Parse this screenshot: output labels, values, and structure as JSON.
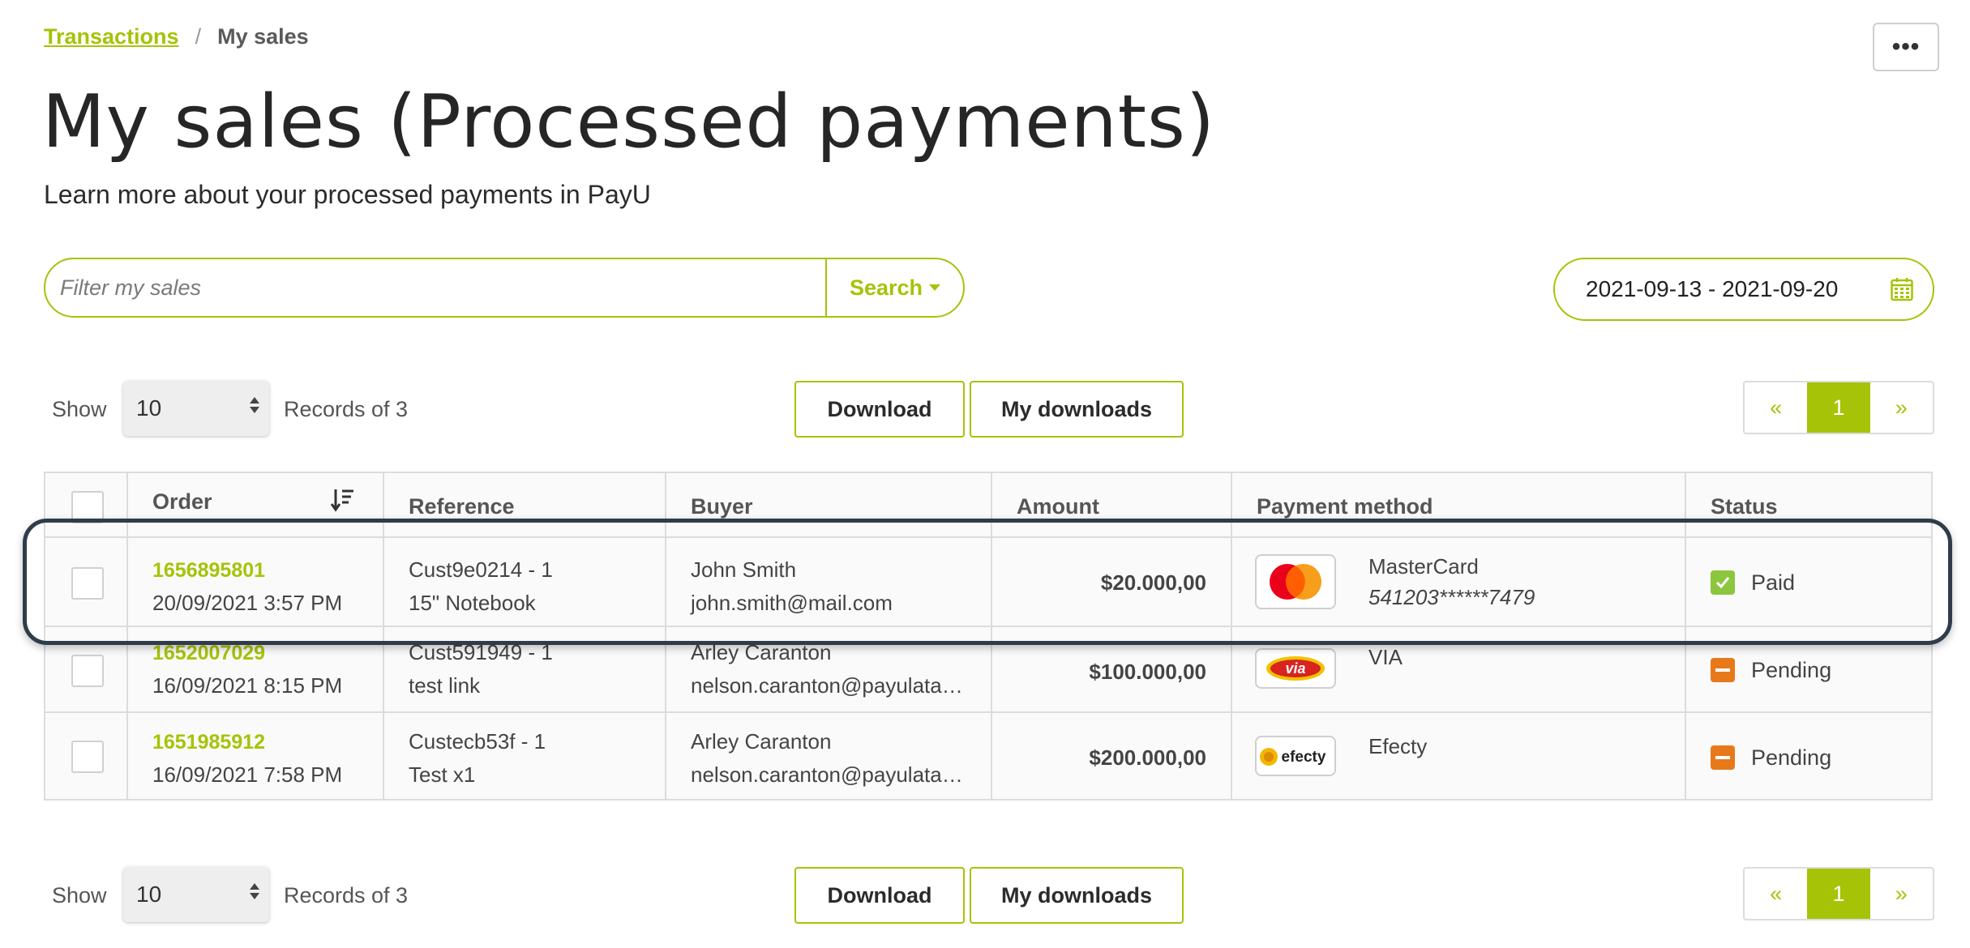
{
  "breadcrumb": {
    "parent": "Transactions",
    "separator": "/",
    "current": "My sales"
  },
  "more_menu": {
    "label": "•••"
  },
  "page": {
    "title": "My sales (Processed payments)",
    "subtitle": "Learn more about your processed payments in PayU"
  },
  "search": {
    "placeholder": "Filter my sales",
    "value": "",
    "button_label": "Search"
  },
  "date_range": {
    "value": "2021-09-13 - 2021-09-20",
    "icon": "calendar-icon"
  },
  "pagination": {
    "show_label": "Show",
    "page_size": "10",
    "records_label": "Records of 3",
    "download_label": "Download",
    "my_downloads_label": "My downloads",
    "prev": "«",
    "current_page": "1",
    "next": "»"
  },
  "table": {
    "headers": [
      "Order",
      "Reference",
      "Buyer",
      "Amount",
      "Payment method",
      "Status"
    ],
    "rows": [
      {
        "order_id": "1656895801",
        "date": "20/09/2021 3:57 PM",
        "ref1": "Cust9e0214 - 1",
        "ref2": "15\" Notebook",
        "buyer_name": "John Smith",
        "buyer_email": "john.smith@mail.com",
        "amount": "$20.000,00",
        "pm_name": "MasterCard",
        "pm_number": "541203******7479",
        "pm_icon": "mastercard-logo",
        "status": "Paid",
        "status_color": "#8cc63f"
      },
      {
        "order_id": "1652007029",
        "date": "16/09/2021 8:15 PM",
        "ref1": "Cust591949 - 1",
        "ref2": "test link",
        "buyer_name": "Arley Caranton",
        "buyer_email": "nelson.caranton@payulata…",
        "amount": "$100.000,00",
        "pm_name": "VIA",
        "pm_number": "",
        "pm_icon": "via-logo",
        "status": "Pending",
        "status_color": "#e8791a"
      },
      {
        "order_id": "1651985912",
        "date": "16/09/2021 7:58 PM",
        "ref1": "Custecb53f - 1",
        "ref2": "Test x1",
        "buyer_name": "Arley Caranton",
        "buyer_email": "nelson.caranton@payulata…",
        "amount": "$200.000,00",
        "pm_name": "Efecty",
        "pm_number": "",
        "pm_icon": "efecty-logo",
        "status": "Pending",
        "status_color": "#e8791a"
      }
    ]
  },
  "logos": {
    "via_text": "via",
    "efecty_text": "efecty"
  },
  "colors": {
    "accent": "#a6c307",
    "border": "#dcdcdc",
    "highlight": "#2e3d4a"
  }
}
